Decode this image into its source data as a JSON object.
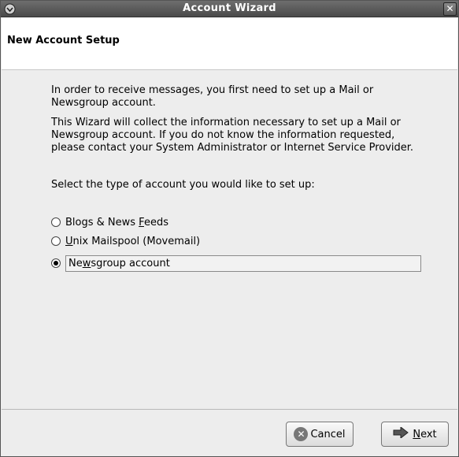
{
  "window": {
    "title": "Account Wizard",
    "close_glyph": "✕"
  },
  "header": {
    "title": "New Account Setup"
  },
  "content": {
    "para1": "In order to receive messages, you first need to set up a Mail or Newsgroup account.",
    "para2": "This Wizard will collect the information necessary to set up a Mail or Newsgroup account. If you do not know the information requested, please contact your System Administrator or Internet Service Provider.",
    "para3": "Select the type of account you would like to set up:",
    "options": [
      {
        "pre": "Blogs & News ",
        "accel": "F",
        "post": "eeds",
        "checked": false
      },
      {
        "pre": "",
        "accel": "U",
        "post": "nix Mailspool (Movemail)",
        "checked": false
      },
      {
        "pre": "Ne",
        "accel": "w",
        "post": "sgroup account",
        "checked": true
      }
    ]
  },
  "buttons": {
    "cancel_label": "Cancel",
    "next_accel": "N",
    "next_rest": "ext"
  },
  "icons": {
    "cancel": "cancel-icon",
    "next": "arrow-right-icon",
    "menu": "window-menu-icon",
    "close": "close-icon"
  },
  "colors": {
    "titlebar": "#5a5a5a",
    "header_bg": "#ffffff",
    "window_bg": "#ededed"
  }
}
